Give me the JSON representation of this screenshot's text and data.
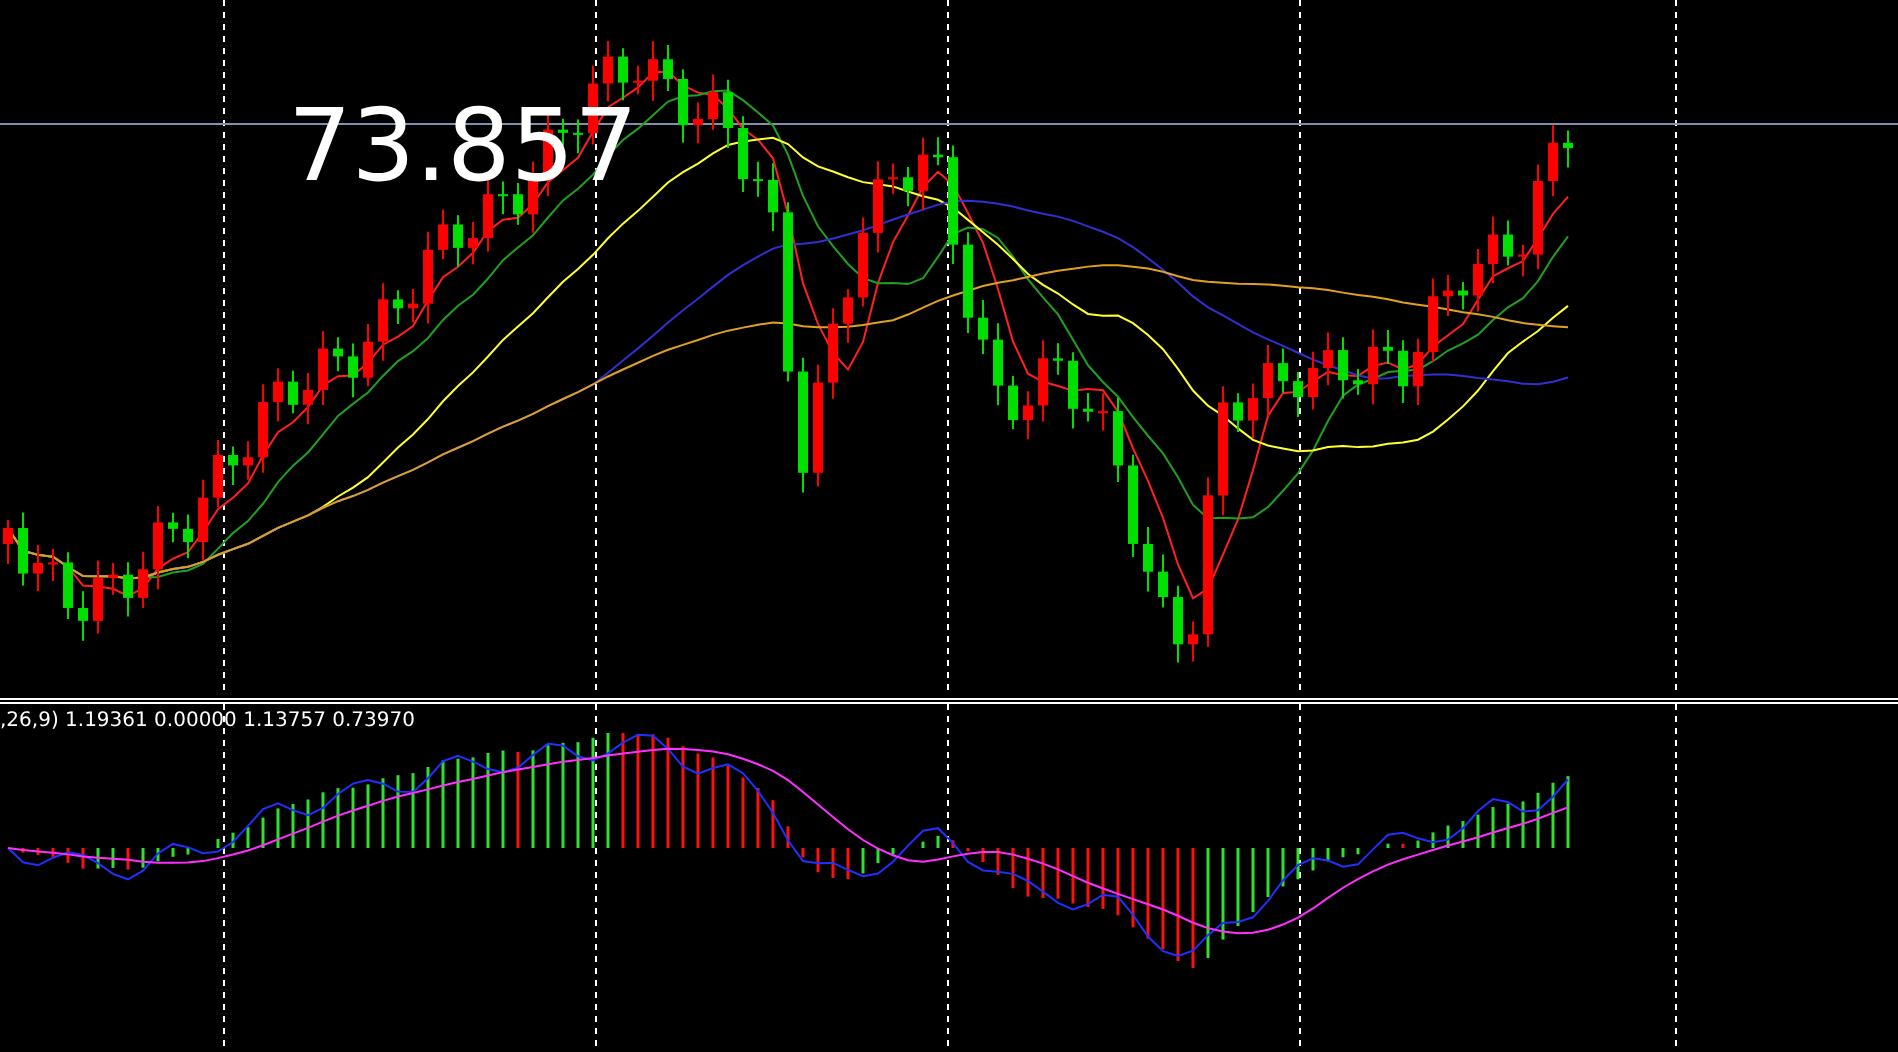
{
  "price_label": "73.857",
  "indicator_label": ",26,9) 1.19361 0.00000 1.13757 0.73970"
}
